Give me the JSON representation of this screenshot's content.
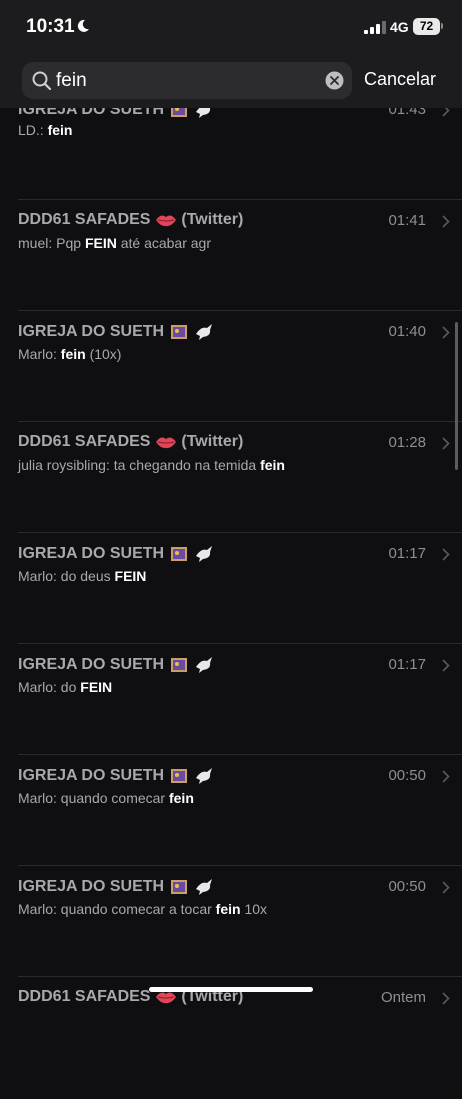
{
  "status_bar": {
    "time": "10:31",
    "network": "4G",
    "battery": "72"
  },
  "search": {
    "query": "fein",
    "cancel_label": "Cancelar"
  },
  "results": [
    {
      "title": "IGREJA DO SUETH",
      "emojis": [
        "art-icon",
        "dove-icon"
      ],
      "time": "01:43",
      "sender": "LD.: ",
      "before": "",
      "match": "fein",
      "after": ""
    },
    {
      "title": "DDD61 SAFADES",
      "emojis": [
        "lips-icon"
      ],
      "suffix": "(Twitter)",
      "time": "01:41",
      "sender": "muel: ",
      "before": "Pqp ",
      "match": "FEIN",
      "after": " até acabar agr"
    },
    {
      "title": "IGREJA DO SUETH",
      "emojis": [
        "art-icon",
        "dove-icon"
      ],
      "time": "01:40",
      "sender": "Marlo: ",
      "before": "",
      "match": "fein",
      "after": " (10x)"
    },
    {
      "title": "DDD61 SAFADES",
      "emojis": [
        "lips-icon"
      ],
      "suffix": "(Twitter)",
      "time": "01:28",
      "sender": "julia roysibling: ",
      "before": "ta chegando na temida ",
      "match": "fein",
      "after": ""
    },
    {
      "title": "IGREJA DO SUETH",
      "emojis": [
        "art-icon",
        "dove-icon"
      ],
      "time": "01:17",
      "sender": "Marlo: ",
      "before": "do deus ",
      "match": "FEIN",
      "after": ""
    },
    {
      "title": "IGREJA DO SUETH",
      "emojis": [
        "art-icon",
        "dove-icon"
      ],
      "time": "01:17",
      "sender": "Marlo: ",
      "before": "do ",
      "match": "FEIN",
      "after": ""
    },
    {
      "title": "IGREJA DO SUETH",
      "emojis": [
        "art-icon",
        "dove-icon"
      ],
      "time": "00:50",
      "sender": "Marlo: ",
      "before": "quando comecar ",
      "match": "fein",
      "after": ""
    },
    {
      "title": "IGREJA DO SUETH",
      "emojis": [
        "art-icon",
        "dove-icon"
      ],
      "time": "00:50",
      "sender": "Marlo: ",
      "before": "quando comecar a tocar ",
      "match": "fein",
      "after": " 10x"
    },
    {
      "title": "DDD61 SAFADES",
      "emojis": [
        "lips-icon"
      ],
      "suffix": "(Twitter)",
      "time": "Ontem",
      "sender": "",
      "before": "",
      "match": "",
      "after": ""
    }
  ]
}
